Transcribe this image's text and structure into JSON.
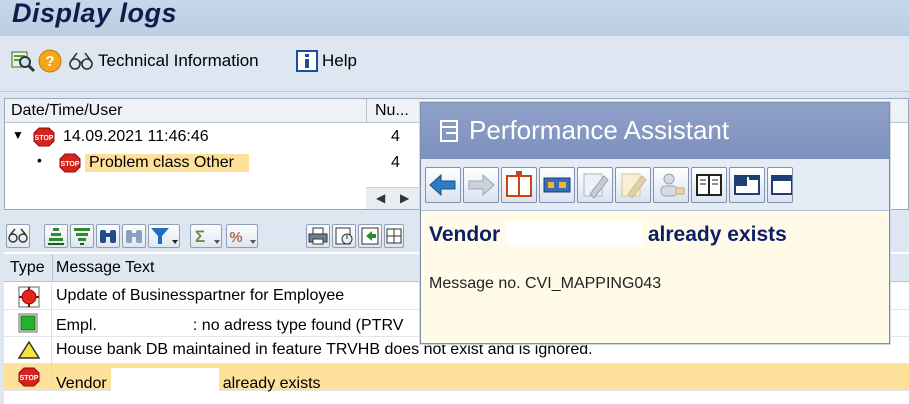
{
  "window": {
    "title": "Display logs"
  },
  "app_toolbar": {
    "technical_info_label": "Technical Information",
    "help_label": "Help"
  },
  "tree": {
    "columns": [
      "Date/Time/User",
      "Nu..."
    ],
    "rows": [
      {
        "label": "14.09.2021  11:46:46",
        "count": "4"
      },
      {
        "label": "Problem class Other",
        "count": "4"
      }
    ]
  },
  "messages": {
    "columns": [
      "Type",
      "Message Text"
    ],
    "rows": [
      {
        "status": "error-red",
        "text": "Update of Businesspartner for Employee"
      },
      {
        "status": "success-green",
        "text_before": "Empl.",
        "text_after": ": no adress type found (PTRV"
      },
      {
        "status": "warning-yellow",
        "text": "House bank DB maintained in feature TRVHB does not exist and is ignored."
      },
      {
        "status": "stop",
        "text_before": "Vendor",
        "text_after": "already exists"
      }
    ]
  },
  "popup": {
    "title": "Performance Assistant",
    "heading_before": "Vendor",
    "heading_after": "already exists",
    "message_no": "Message no. CVI_MAPPING043"
  },
  "colors": {
    "title_text": "#0b1f4b",
    "selection": "#fde09a",
    "popup_title_bg": "#8fa1c9",
    "popup_heading": "#0c1f66"
  }
}
